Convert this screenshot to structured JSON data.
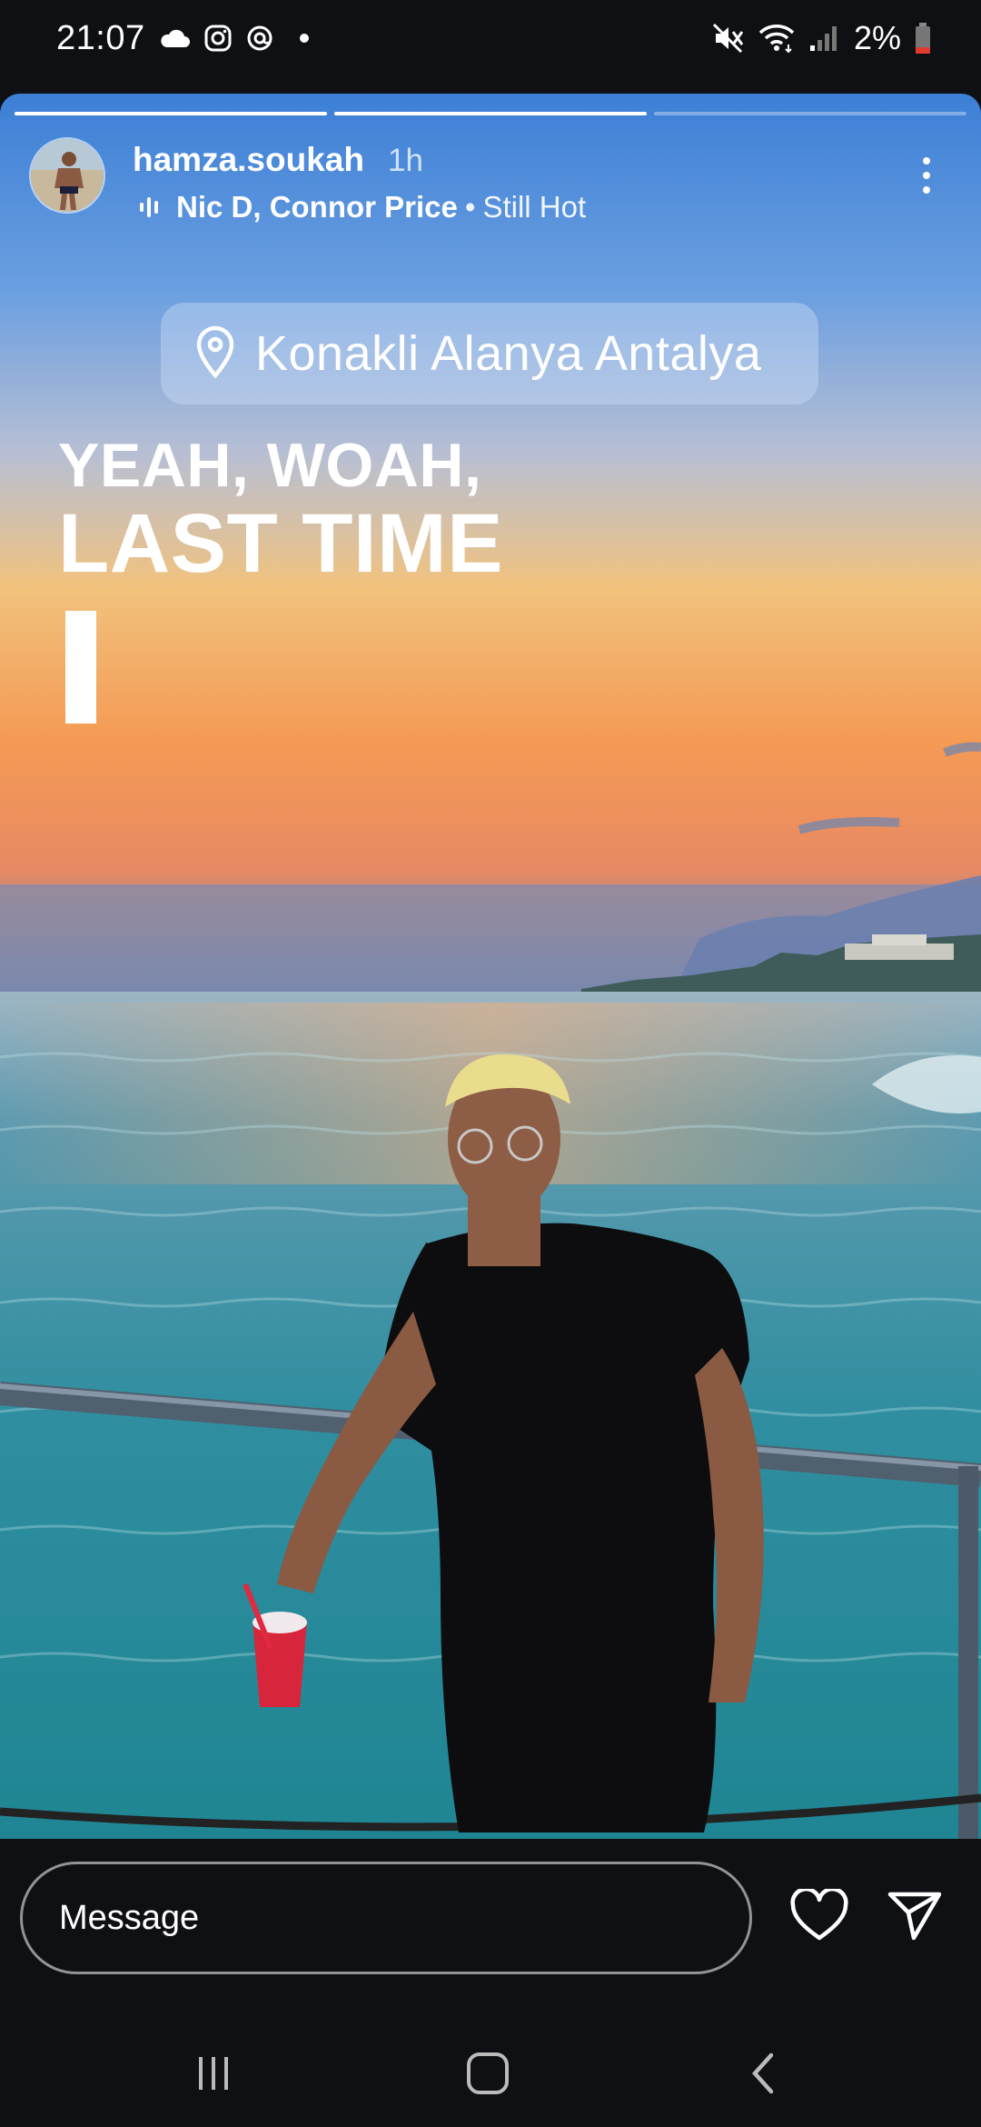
{
  "status_bar": {
    "time": "21:07",
    "battery": "2%",
    "left_icons": [
      "cloud-icon",
      "instagram-icon",
      "threads-icon",
      "notification-dot"
    ],
    "right_icons": [
      "mute-icon",
      "wifi-icon",
      "signal-icon",
      "battery-icon"
    ]
  },
  "story": {
    "progress": [
      1.0,
      1.0,
      0.0
    ],
    "user": {
      "username": "hamza.soukah",
      "time_ago": "1h"
    },
    "music": {
      "artists": "Nic D, Connor Price",
      "separator": "•",
      "song": "Still Hot"
    },
    "location": "Konakli Alanya Antalya",
    "lyrics": {
      "line1": "YEAH, WOAH,",
      "line2": "LAST TIME"
    }
  },
  "reply": {
    "placeholder": "Message"
  },
  "nav": {
    "buttons": [
      "recents-icon",
      "home-icon",
      "back-icon"
    ]
  },
  "colors": {
    "background": "#0f1014",
    "text": "#ffffff"
  }
}
